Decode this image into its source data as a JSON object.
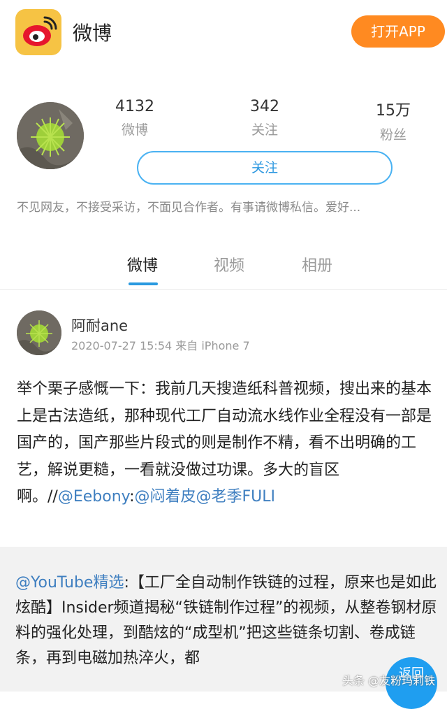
{
  "header": {
    "app_name": "微博",
    "open_app_label": "打开APP"
  },
  "profile": {
    "stats": [
      {
        "value": "4132",
        "label": "微博"
      },
      {
        "value": "342",
        "label": "关注"
      },
      {
        "value": "15万",
        "label": "粉丝"
      }
    ],
    "follow_label": "关注",
    "bio": "不见网友，不接受采访，不面见合作者。有事请微博私信。爱好..."
  },
  "tabs": [
    {
      "label": "微博",
      "active": true
    },
    {
      "label": "视频",
      "active": false
    },
    {
      "label": "相册",
      "active": false
    }
  ],
  "post": {
    "author": "阿耐ane",
    "meta": "2020-07-27 15:54 来自 iPhone 7",
    "text": "举个栗子感慨一下：我前几天搜造纸科普视频，搜出来的基本上是古法造纸，那种现代工厂自动流水线作业全程没有一部是国产的，国产那些片段式的则是制作不精，看不出明确的工艺，解说更糙，一看就没做过功课。多大的盲区啊。//",
    "mention_1": "@Eebony",
    "colon": ":",
    "mention_2": "@闷着皮",
    "mention_3": "@老季FULI"
  },
  "repost": {
    "source": "@YouTube精选",
    "text": ":【工厂全自动制作铁链的过程，原来也是如此炫酷】Insider频道揭秘“铁链制作过程”的视频，从整卷钢材原料的强化处理，到酷炫的“成型机”把这些链条切割、卷成链条，再到电磁加热淬火，都"
  },
  "back_button_label": "返回",
  "watermark": "头条 @友粉玛莉铁",
  "colors": {
    "accent": "#ff8a21",
    "link": "#3f7fc0",
    "tab_indicator": "#2a9ae0"
  }
}
